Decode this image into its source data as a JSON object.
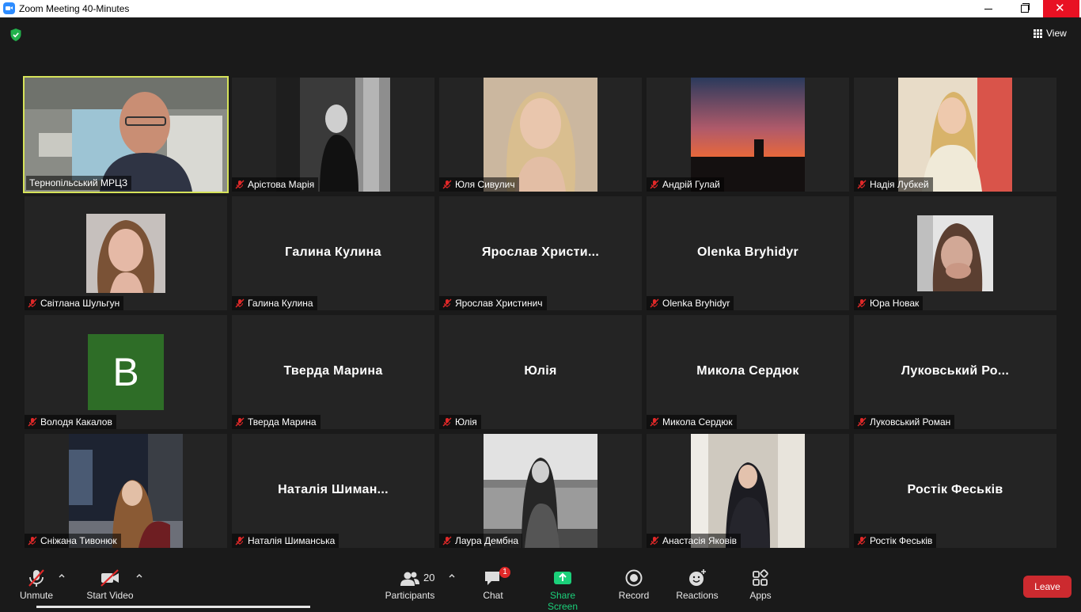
{
  "window": {
    "title": "Zoom Meeting 40-Minutes",
    "close_symbol": "✕"
  },
  "header": {
    "view_label": "View"
  },
  "tiles": [
    {
      "name": "Тернопільський МРЦЗ",
      "muted": false,
      "display": "video"
    },
    {
      "name": "Арістова Марія",
      "muted": true,
      "display": "photo"
    },
    {
      "name": "Юля Сивулич",
      "muted": true,
      "display": "photo"
    },
    {
      "name": "Андрій Гулай",
      "muted": true,
      "display": "photo"
    },
    {
      "name": "Надія Лубкей",
      "muted": true,
      "display": "photo"
    },
    {
      "name": "Світлана Шульгун",
      "muted": true,
      "display": "photo"
    },
    {
      "name": "Галина Кулина",
      "muted": true,
      "display": "name",
      "big_name": "Галина Кулина"
    },
    {
      "name": "Ярослав Христинич",
      "muted": true,
      "display": "name",
      "big_name": "Ярослав  Христи..."
    },
    {
      "name": "Olenka Bryhidyr",
      "muted": true,
      "display": "name",
      "big_name": "Olenka Bryhidyr"
    },
    {
      "name": "Юра Новак",
      "muted": true,
      "display": "photo"
    },
    {
      "name": "Володя Какалов",
      "muted": true,
      "display": "avatar",
      "avatar_letter": "B",
      "avatar_color": "#2e6d27"
    },
    {
      "name": "Тверда Марина",
      "muted": true,
      "display": "name",
      "big_name": "Тверда Марина"
    },
    {
      "name": "Юлія",
      "muted": true,
      "display": "name",
      "big_name": "Юлія"
    },
    {
      "name": "Микола Сердюк",
      "muted": true,
      "display": "name",
      "big_name": "Микола Сердюк"
    },
    {
      "name": "Луковський Роман",
      "muted": true,
      "display": "name",
      "big_name": "Луковський  Ро..."
    },
    {
      "name": "Сніжана Тивонюк",
      "muted": true,
      "display": "photo"
    },
    {
      "name": "Наталія Шиманська",
      "muted": true,
      "display": "name",
      "big_name": "Наталія  Шиман..."
    },
    {
      "name": "Лаура Дембна",
      "muted": true,
      "display": "photo"
    },
    {
      "name": "Анастасія Яковів",
      "muted": true,
      "display": "photo"
    },
    {
      "name": "Ростік Феськів",
      "muted": true,
      "display": "name",
      "big_name": "Ростік Феськів"
    }
  ],
  "toolbar": {
    "unmute": "Unmute",
    "start_video": "Start Video",
    "participants": "Participants",
    "participants_count": "20",
    "chat": "Chat",
    "chat_badge": "1",
    "share_screen": "Share Screen",
    "record": "Record",
    "reactions": "Reactions",
    "apps": "Apps",
    "leave": "Leave"
  },
  "colors": {
    "active_speaker": "#d6e35a",
    "share_green": "#1bd07a",
    "leave_red": "#cc2a2f",
    "mute_red": "#e02828"
  }
}
